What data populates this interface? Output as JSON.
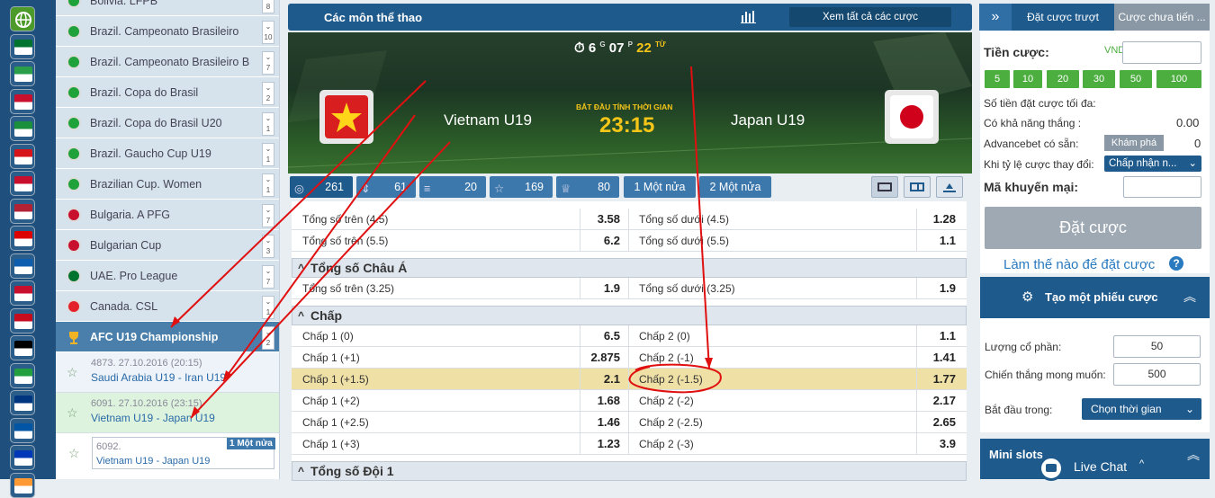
{
  "flags_column": {
    "globe": "globe-icon",
    "colors": [
      "#3a7a3a",
      "#00732f",
      "#2b9e4a",
      "#c8102e",
      "#1a8f3c",
      "#d7141a",
      "#c8102e",
      "#b22234",
      "#dd0000",
      "#0d5eaf",
      "#c8102e",
      "#c60b1e",
      "#000000",
      "#239f40",
      "#003580",
      "#0055a4",
      "#0038b8",
      "#ff9933"
    ]
  },
  "leagues": {
    "items": [
      {
        "name": "Bolivia. LFPB",
        "count": "8",
        "icon": "brazil-flag"
      },
      {
        "name": "Brazil. Campeonato Brasileiro",
        "count": "10",
        "icon": "brazil-flag"
      },
      {
        "name": "Brazil. Campeonato Brasileiro B",
        "count": "7",
        "icon": "brazil-flag"
      },
      {
        "name": "Brazil. Copa do Brasil",
        "count": "2",
        "icon": "brazil-flag"
      },
      {
        "name": "Brazil. Copa do Brasil U20",
        "count": "1",
        "icon": "brazil-flag"
      },
      {
        "name": "Brazil. Gaucho Cup U19",
        "count": "1",
        "icon": "brazil-flag"
      },
      {
        "name": "Brazilian Cup. Women",
        "count": "1",
        "icon": "brazil-flag"
      },
      {
        "name": "Bulgaria. A PFG",
        "count": "7",
        "icon": "bulgaria-flag"
      },
      {
        "name": "Bulgarian Cup",
        "count": "3",
        "icon": "bulgaria-flag"
      },
      {
        "name": "UAE. Pro League",
        "count": "7",
        "icon": "uae-flag"
      },
      {
        "name": "Canada. CSL",
        "count": "1",
        "icon": "canada-flag"
      },
      {
        "name": "AFC U19 Championship",
        "count": "2",
        "icon": "trophy-icon"
      }
    ],
    "events": [
      {
        "date": "4873. 27.10.2016 (20:15)",
        "teams": "Saudi Arabia U19 - Iran U19"
      },
      {
        "date": "6091. 27.10.2016 (23:15)",
        "teams": "Vietnam U19 - Japan U19"
      }
    ],
    "sub_event": {
      "id": "6092.",
      "teams": "Vietnam U19 - Japan U19",
      "badge": "1 Một nửa"
    }
  },
  "main": {
    "header_title": "Các môn thể thao",
    "see_all": "Xem tất cả các cược",
    "countdown": {
      "d": "6",
      "d_unit": "G",
      "h": "07",
      "h_unit": "P",
      "m": "22",
      "m_unit": "TỪ"
    },
    "home_team": "Vietnam U19",
    "away_team": "Japan U19",
    "start_label": "BẮT ĐẦU TÍNH THỜI GIAN",
    "start_time": "23:15",
    "tabs": [
      {
        "icon": "target-icon",
        "value": "261"
      },
      {
        "icon": "sort-icon",
        "value": "61"
      },
      {
        "icon": "list-icon",
        "value": "20"
      },
      {
        "icon": "star-icon",
        "value": "169"
      },
      {
        "icon": "trophy-icon",
        "value": "80"
      }
    ],
    "half_tabs": [
      "1 Một nửa",
      "2 Một nửa"
    ]
  },
  "odds": {
    "totals_rows": [
      {
        "l": "Tổng số trên (4.5)",
        "lv": "3.58",
        "r": "Tổng số dưới (4.5)",
        "rv": "1.28"
      },
      {
        "l": "Tổng số trên (5.5)",
        "lv": "6.2",
        "r": "Tổng số dưới (5.5)",
        "rv": "1.1"
      }
    ],
    "asian_title": "Tổng số Châu Á",
    "asian_rows": [
      {
        "l": "Tổng số trên (3.25)",
        "lv": "1.9",
        "r": "Tổng số dưới (3.25)",
        "rv": "1.9"
      }
    ],
    "handicap_title": "Chấp",
    "handicap_rows": [
      {
        "l": "Chấp 1 (0)",
        "lv": "6.5",
        "r": "Chấp 2 (0)",
        "rv": "1.1"
      },
      {
        "l": "Chấp 1 (+1)",
        "lv": "2.875",
        "r": "Chấp 2 (-1)",
        "rv": "1.41"
      },
      {
        "l": "Chấp 1 (+1.5)",
        "lv": "2.1",
        "r": "Chấp 2 (-1.5)",
        "rv": "1.77"
      },
      {
        "l": "Chấp 1 (+2)",
        "lv": "1.68",
        "r": "Chấp 2 (-2)",
        "rv": "2.17"
      },
      {
        "l": "Chấp 1 (+2.5)",
        "lv": "1.46",
        "r": "Chấp 2 (-2.5)",
        "rv": "2.65"
      },
      {
        "l": "Chấp 1 (+3)",
        "lv": "1.23",
        "r": "Chấp 2 (-3)",
        "rv": "3.9"
      }
    ],
    "team1_title": "Tổng số Đội 1"
  },
  "betslip": {
    "tab_active": "Đặt cược trượt",
    "tab_other": "Cược chưa tiến ...",
    "stake_label": "Tiền cược:",
    "currency": "VND",
    "quick": [
      "5",
      "10",
      "20",
      "30",
      "50",
      "100"
    ],
    "max_label": "Số tiền đặt cược tối đa:",
    "win_label": "Có khả năng thắng :",
    "win_value": "0.00",
    "advance_label": "Advancebet có sẵn:",
    "advance_btn": "Khám phá",
    "advance_value": "0",
    "odds_change_label": "Khi tỷ lệ cược thay đổi:",
    "odds_change_value": "Chấp nhận n...",
    "promo_label": "Mã khuyến mại:",
    "place_btn": "Đặt cược",
    "how_link": "Làm thế nào để đặt cược",
    "create_title": "Tạo một phiếu cược",
    "shares_label": "Lượng cổ phần:",
    "shares_value": "50",
    "desired_label": "Chiến thắng mong muốn:",
    "desired_value": "500",
    "start_label": "Bắt đầu trong:",
    "start_select": "Chọn thời gian",
    "mini_slots": "Mini slots",
    "live_chat": "Live Chat"
  }
}
